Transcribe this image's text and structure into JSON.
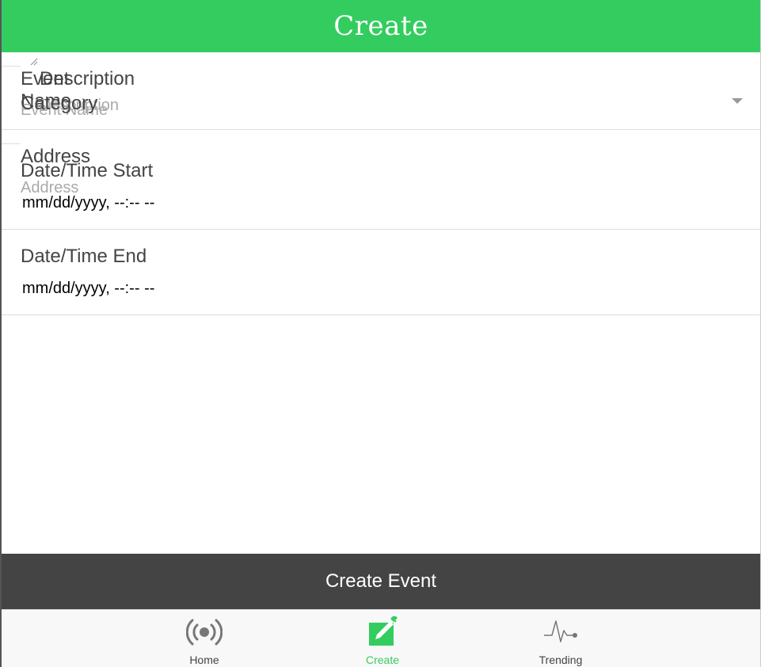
{
  "header": {
    "title": "Create"
  },
  "form": {
    "event_name": {
      "label": "Event Name",
      "placeholder": "Event Name",
      "value": ""
    },
    "description": {
      "label": "Description",
      "placeholder": "Description",
      "value": ""
    },
    "category": {
      "label": "Category",
      "selected": ""
    },
    "address": {
      "label": "Address",
      "placeholder": "Address",
      "value": ""
    },
    "date_start": {
      "label": "Date/Time Start",
      "value": "mm/dd/yyyy, --:-- --"
    },
    "date_end": {
      "label": "Date/Time End",
      "value": "mm/dd/yyyy, --:-- --"
    },
    "submit_label": "Create Event"
  },
  "tabs": [
    {
      "label": "Home",
      "icon": "broadcast-icon",
      "active": false
    },
    {
      "label": "Create",
      "icon": "compose-icon",
      "active": true
    },
    {
      "label": "Trending",
      "icon": "pulse-icon",
      "active": false
    }
  ],
  "colors": {
    "header": "#33cd5f",
    "active_tab": "#33cd5f",
    "submit_bg": "#444444",
    "tabbar_bg": "#f8f8f8"
  }
}
